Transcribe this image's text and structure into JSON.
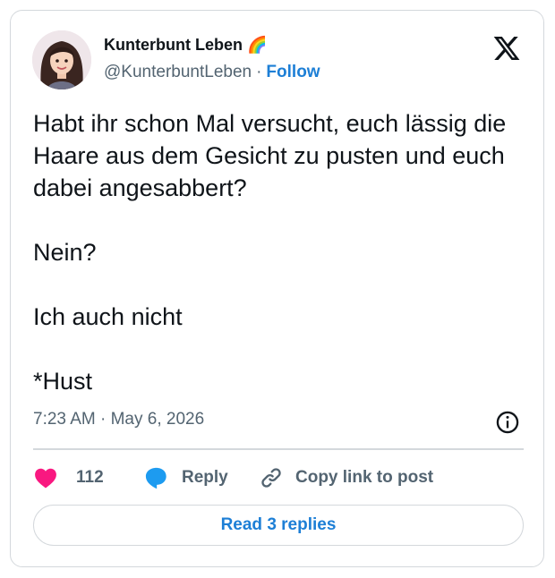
{
  "author": {
    "name": "Kunterbunt Leben 🌈",
    "handle": "@KunterbuntLeben",
    "separator": "·",
    "follow_label": "Follow"
  },
  "logo": {
    "icon": "x-logo-icon",
    "color": "#0f1419"
  },
  "tweet": {
    "paragraphs": [
      "Habt ihr schon Mal versucht, euch lässig die Haare aus dem Gesicht zu pusten und euch dabei angesabbert?",
      "Nein?",
      "Ich auch nicht",
      "*Hust"
    ],
    "timestamp": "7:23 AM · May 6, 2026"
  },
  "actions": {
    "like_count": "112",
    "reply_label": "Reply",
    "copy_label": "Copy link to post"
  },
  "read_replies_label": "Read 3 replies",
  "colors": {
    "accent": "#1d7fd6",
    "like": "#f91880",
    "reply": "#1d9bf0",
    "muted": "#536471",
    "border": "#d4d8dc"
  }
}
